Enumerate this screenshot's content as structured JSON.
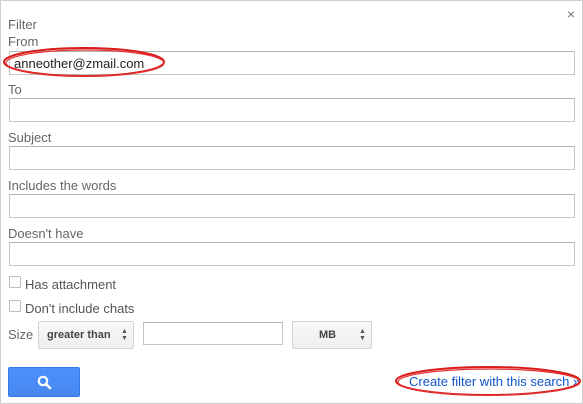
{
  "dialog": {
    "title": "Filter",
    "close_glyph": "×"
  },
  "fields": {
    "from_label": "From",
    "from_value": "anneother@zmail.com",
    "to_label": "To",
    "to_value": "",
    "subject_label": "Subject",
    "subject_value": "",
    "includes_label": "Includes the words",
    "includes_value": "",
    "doesnt_have_label": "Doesn't have",
    "doesnt_have_value": ""
  },
  "options": {
    "has_attachment_label": "Has attachment",
    "has_attachment_checked": false,
    "dont_include_chats_label": "Don't include chats",
    "dont_include_chats_checked": false
  },
  "size": {
    "label": "Size",
    "comparator": "greater than",
    "value": "",
    "unit": "MB"
  },
  "actions": {
    "search_icon": "search-icon",
    "create_filter_label": "Create filter with this search »"
  },
  "colors": {
    "link": "#1155cc",
    "button": "#4d90fe",
    "annotation": "#d81b1b"
  }
}
